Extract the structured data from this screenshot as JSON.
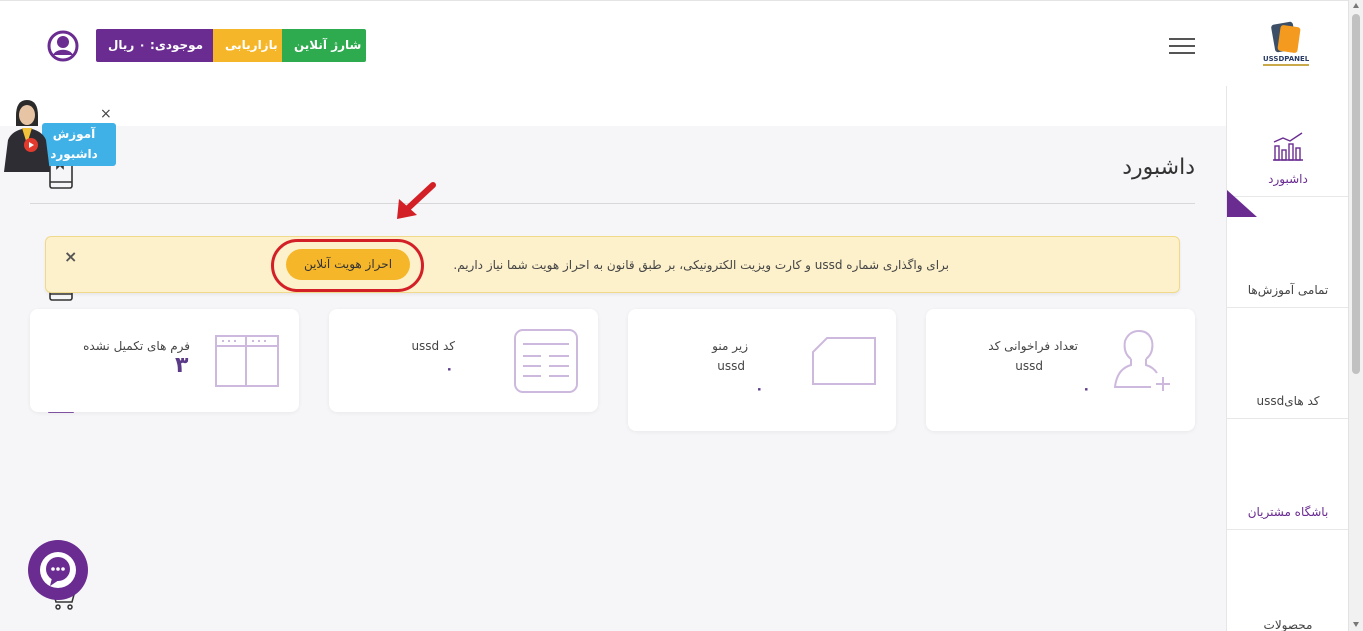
{
  "header": {
    "brand_name": "USSDPANEL",
    "balance_label": "موجودی: ۰ ریال",
    "marketing_label": "بازاریابی",
    "charge_label": "شارژ آنلاین"
  },
  "sidebar": {
    "items": [
      {
        "label": "داشبورد",
        "icon": "chart-icon",
        "active": true
      },
      {
        "label": "تمامی آموزش‌ها",
        "icon": "book-icon"
      },
      {
        "label": "کد هایussd",
        "icon": "book-icon"
      },
      {
        "label": "باشگاه مشتریان",
        "icon": "store-icon"
      },
      {
        "label": "محصولات",
        "icon": "cart-icon"
      }
    ]
  },
  "tutorial": {
    "line1": "آموزش",
    "line2": "داشبورد",
    "close": "×"
  },
  "page": {
    "title": "داشبورد"
  },
  "alert": {
    "message": "برای واگذاری شماره ussd و کارت ویزیت الکترونیکی، بر طبق قانون به احراز هویت شما نیاز داریم.",
    "button": "احراز هویت آنلاین",
    "close": "×"
  },
  "cards": [
    {
      "title": "تعداد فراخوانی کد",
      "subtitle": "ussd",
      "value": "۰",
      "icon": "user-add-icon"
    },
    {
      "title": "زیر منو",
      "subtitle": "ussd",
      "value": "۰",
      "icon": "folder-icon"
    },
    {
      "title": "کد ussd",
      "subtitle": "",
      "value": "۰",
      "icon": "document-icon"
    },
    {
      "title": "فرم های تکمیل نشده",
      "subtitle": "",
      "value": "۳",
      "icon": "form-icon"
    }
  ],
  "colors": {
    "primary": "#6a2c91",
    "warning": "#f6b62a",
    "success": "#2eaa4f",
    "alert_bg": "#fdf1cc",
    "highlight": "#d32027"
  }
}
